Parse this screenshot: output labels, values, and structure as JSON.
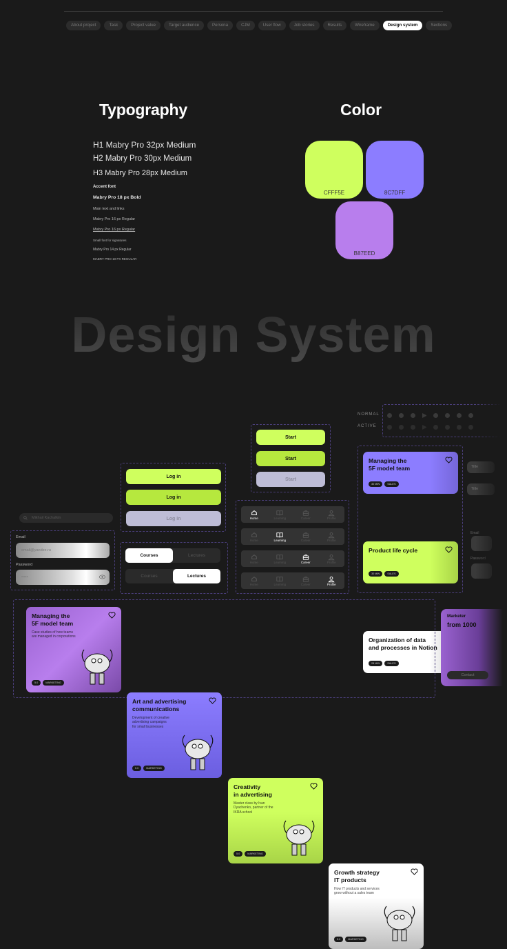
{
  "nav": {
    "tabs": [
      "About project",
      "Task",
      "Project value",
      "Target audience",
      "Persona",
      "CJM",
      "User flow",
      "Job stories",
      "Results",
      "Wireframe",
      "Design system",
      "Sections"
    ],
    "active": "Design system"
  },
  "typography": {
    "title": "Typography",
    "h1": "H1 Mabry Pro  32px Medium",
    "h2": "H2 Mabry Pro 30px Medium",
    "h3": "H3 Mabry Pro 28px Medium",
    "accent_label": "Accent font",
    "accent_spec": "Mabry Pro  18 px Bold",
    "main_label": "Main text and links",
    "main_spec": "Mabry Pro 16 px Regular",
    "link_spec": "Mabry Pro 16 px Regular",
    "small_label": "Small font for signatures",
    "small_spec": "Mabry Pro 14 px Regular",
    "caps_spec": "MABRY PRO 10 PX REGULAR"
  },
  "color": {
    "title": "Color",
    "swatches": [
      {
        "hex": "#CFFF5E",
        "label": "CFFF5E"
      },
      {
        "hex": "#8C7DFF",
        "label": "8C7DFF"
      },
      {
        "hex": "#B87EED",
        "label": "B87EED"
      }
    ]
  },
  "hero": {
    "title": "Design System"
  },
  "controls": {
    "normal_label": "NORMAL",
    "active_label": "ACTIVE"
  },
  "buttons": {
    "login": [
      "Log in",
      "Log in",
      "Log in"
    ],
    "start": [
      "Start",
      "Start",
      "Start"
    ]
  },
  "search": {
    "placeholder": "Mikhail Kachalkin"
  },
  "form": {
    "email_label": "Email",
    "email_value": "email@yandex.ru",
    "password_label": "Password",
    "password_value": "•••••"
  },
  "segmented": {
    "options": [
      "Courses",
      "Lectures"
    ]
  },
  "tabbar": {
    "items": [
      "Home",
      "Learning",
      "Career",
      "Profile"
    ]
  },
  "side_cards": [
    {
      "title": "Managing the\n5F model team",
      "tags": [
        "30 MIN",
        "SALES"
      ]
    },
    {
      "title": "Product life cycle",
      "tags": [
        "30 MIN",
        "SALES"
      ]
    },
    {
      "title": "Organization of data\nand processes in Notion",
      "tags": [
        "28 MIN",
        "SALES"
      ]
    }
  ],
  "course_cards": [
    {
      "title": "Managing the\n5F model team",
      "desc": "Case studies of how teams\nare managed in corporations",
      "tags": [
        "5.0",
        "MARKETING"
      ]
    },
    {
      "title": "Art and advertising\ncommunications",
      "desc": "Development of creative\nadvertising campaigns\nfor small businesses",
      "tags": [
        "5.0",
        "MARKETING"
      ]
    },
    {
      "title": "Creativity\nin advertising",
      "desc": "Master class by Ivan\nDyachenko, partner of the\nIKRA school",
      "tags": [
        "5.0",
        "MARKETING"
      ]
    },
    {
      "title": "Growth strategy\nIT products",
      "desc": "How IT products and services\ngrow without a sales team",
      "tags": [
        "5.0",
        "MARKETING"
      ]
    }
  ],
  "vacancy": {
    "role": "Marketer",
    "salary": "from 1000",
    "button": "Contact"
  },
  "right_stub": {
    "title": "Title",
    "email_label": "Email",
    "password_label": "Password"
  }
}
